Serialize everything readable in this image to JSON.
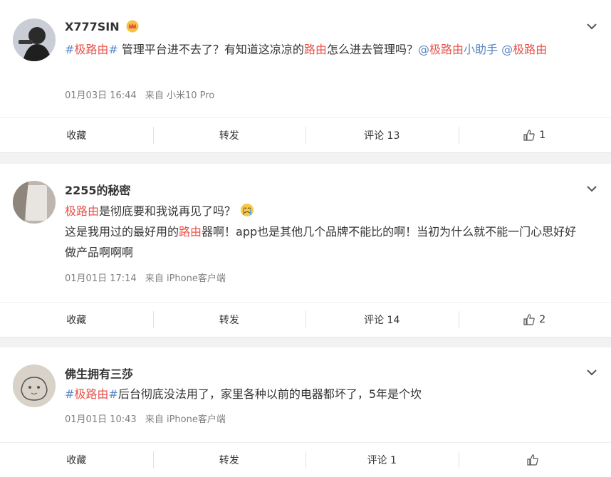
{
  "posts": [
    {
      "username": "X777SIN",
      "text": [
        {
          "t": "#",
          "c": "blue"
        },
        {
          "t": "极路由",
          "c": "red"
        },
        {
          "t": "#",
          "c": "blue"
        },
        {
          "t": " 管理平台进不去了？有知道这凉凉的",
          "c": ""
        },
        {
          "t": "路由",
          "c": "red"
        },
        {
          "t": "怎么进去管理吗？",
          "c": ""
        },
        {
          "t": "@",
          "c": "blue"
        },
        {
          "t": "极路由",
          "c": "red"
        },
        {
          "t": "小助手 ",
          "c": "blue"
        },
        {
          "t": "@",
          "c": "blue"
        },
        {
          "t": "极路由",
          "c": "red"
        }
      ],
      "date": "01月03日 16:44",
      "source": "来自 小米10 Pro",
      "actions": {
        "collect": "收藏",
        "repost": "转发",
        "comment": "评论 13",
        "like": "1"
      }
    },
    {
      "username": "2255的秘密",
      "text": [
        {
          "t": "极路由",
          "c": "red"
        },
        {
          "t": "是彻底要和我说再见了吗？",
          "c": ""
        },
        {
          "t": "[emoji]",
          "c": "emoji"
        },
        {
          "t": "\n这是我用过的最好用的",
          "c": ""
        },
        {
          "t": "路由",
          "c": "red"
        },
        {
          "t": "器啊！app也是其他几个品牌不能比的啊！当初为什么就不能一门心思好好做产品啊啊啊",
          "c": ""
        }
      ],
      "date": "01月01日 17:14",
      "source": "来自 iPhone客户端",
      "actions": {
        "collect": "收藏",
        "repost": "转发",
        "comment": "评论 14",
        "like": "2"
      }
    },
    {
      "username": "佛生拥有三莎",
      "text": [
        {
          "t": "#",
          "c": "blue"
        },
        {
          "t": "极路由",
          "c": "red"
        },
        {
          "t": "#",
          "c": "blue"
        },
        {
          "t": "后台彻底没法用了，家里各种以前的电器都坏了，5年是个坎",
          "c": ""
        }
      ],
      "date": "01月01日 10:43",
      "source": "来自 iPhone客户端",
      "actions": {
        "collect": "收藏",
        "repost": "转发",
        "comment": "评论 1",
        "like": ""
      }
    }
  ],
  "colors": {
    "red": "#e8534a",
    "blue": "#5b87c4",
    "meta": "#808080"
  },
  "icons": {
    "expand": "chevron-down-icon",
    "like": "thumbs-up-icon",
    "badge": "crown-icon",
    "emoji": "crying-face-icon"
  }
}
